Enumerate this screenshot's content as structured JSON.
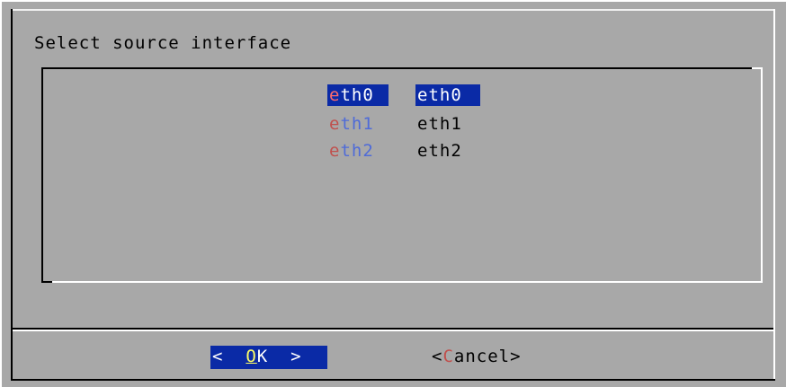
{
  "dialog": {
    "title": "Select source interface"
  },
  "menu": {
    "items": [
      {
        "tag_first": "e",
        "tag_rest": "th0",
        "item": "eth0",
        "selected": true
      },
      {
        "tag_first": "e",
        "tag_rest": "th1",
        "item": "eth1",
        "selected": false
      },
      {
        "tag_first": "e",
        "tag_rest": "th2",
        "item": "eth2",
        "selected": false
      }
    ]
  },
  "buttons": {
    "ok": {
      "left": "<  ",
      "hotkey": "O",
      "rest": "K  ",
      "right": ">"
    },
    "cancel": {
      "left": "<",
      "hotkey": "C",
      "rest": "ancel",
      "right": ">"
    }
  },
  "colors": {
    "background": "#a8a8a8",
    "selection": "#0a2aa6",
    "hotkey_red": "#c0504d",
    "tag_blue": "#4f6bd8",
    "hotkey_yellow": "#ffff66"
  }
}
